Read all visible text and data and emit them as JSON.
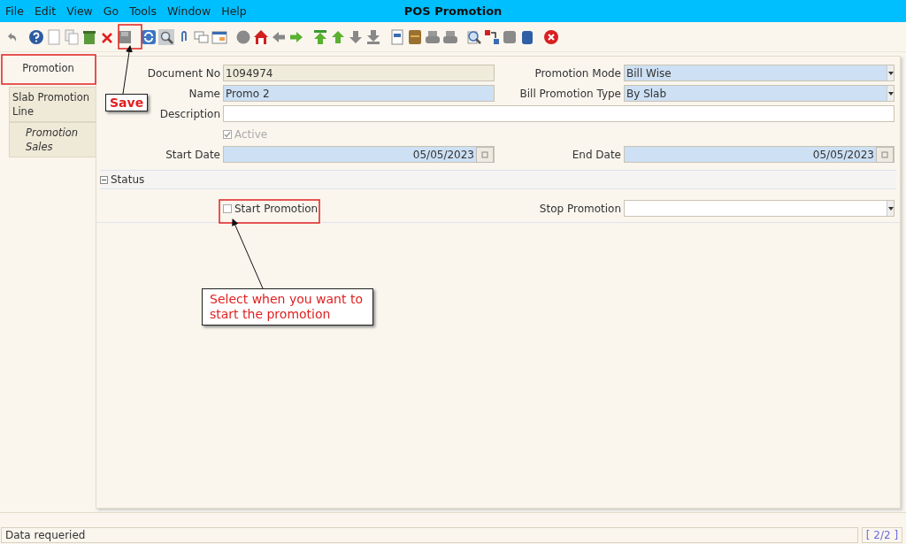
{
  "window": {
    "title": "POS Promotion"
  },
  "menu": [
    "File",
    "Edit",
    "View",
    "Go",
    "Tools",
    "Window",
    "Help"
  ],
  "tabs": [
    {
      "label": "Promotion",
      "selected": true,
      "kind": "tab"
    },
    {
      "label": "Slab Promotion Line",
      "selected": false,
      "kind": "tab"
    },
    {
      "label": "Promotion Sales",
      "selected": false,
      "kind": "subtab"
    }
  ],
  "rows": [
    [
      {
        "label": "Document No",
        "value": "1094974",
        "kind": "readonly"
      },
      {
        "label": "Promotion Mode",
        "value": "Bill Wise",
        "kind": "dropdown",
        "mandatory": true
      }
    ],
    [
      {
        "label": "Name",
        "value": "Promo 2",
        "kind": "text",
        "mandatory": true
      },
      {
        "label": "Bill Promotion Type",
        "value": "By Slab",
        "kind": "dropdown",
        "mandatory": true
      }
    ],
    [
      {
        "label": "Description",
        "kind": "text",
        "mandatory": false
      }
    ],
    [
      {
        "label": "Active",
        "kind": "checkbox",
        "checked": true,
        "disabled": true
      }
    ],
    [
      {
        "label": "Start Date",
        "value": "05/05/2023",
        "kind": "date",
        "mandatory": true
      },
      {
        "label": "End Date",
        "value": "05/05/2023",
        "kind": "date",
        "mandatory": true
      }
    ]
  ],
  "status_section": {
    "title": "Status",
    "expanded": true,
    "fields": [
      {
        "label": "Start Promotion",
        "kind": "checkbox",
        "checked": false,
        "disabled": false
      },
      {
        "label": "Stop Promotion",
        "kind": "dropdown",
        "mandatory": false
      }
    ]
  },
  "annotations": [
    {
      "text": "Save"
    },
    {
      "text": "Select when you want to start the promotion"
    }
  ],
  "status_bar": {
    "message": "Data requeried",
    "record": "[ 2/2 ]"
  }
}
